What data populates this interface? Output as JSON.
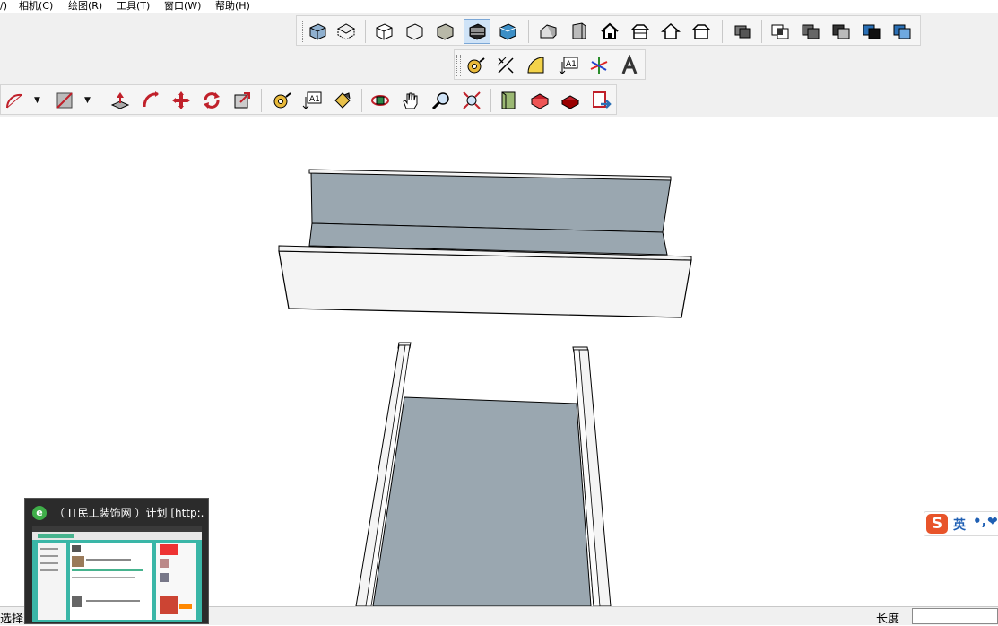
{
  "menu": [
    "/)",
    "相机(C)",
    "绘图(R)",
    "工具(T)",
    "窗口(W)",
    "帮助(H)"
  ],
  "toolbars": {
    "views": [
      "iso-view-icon",
      "top-view-icon",
      "front-view-icon",
      "right-view-icon",
      "back-view-icon",
      "left-view-icon"
    ],
    "styles": [
      "xray-style-icon",
      "wireframe-style-icon",
      "hidden-line-style-icon",
      "shaded-style-icon",
      "shaded-texture-style-icon",
      "monochrome-style-icon"
    ],
    "sections": [
      "outer-shell-icon",
      "intersect-icon",
      "union-icon",
      "subtract-icon",
      "trim-icon",
      "split-icon"
    ],
    "construction": [
      "tape-measure-icon",
      "dimension-icon",
      "protractor-icon",
      "text-label-icon",
      "axes-icon",
      "3d-text-icon"
    ],
    "main": [
      "arc-icon",
      "rectangle-icon",
      "push-pull-icon",
      "follow-me-icon",
      "move-icon",
      "rotate-icon",
      "scale-icon",
      "tape-measure-icon",
      "text-label-icon",
      "paint-bucket-icon",
      "orbit-icon",
      "pan-icon",
      "zoom-icon",
      "zoom-extents-icon",
      "3d-warehouse-icon",
      "extension-warehouse-icon",
      "share-model-icon",
      "layout-send-icon"
    ]
  },
  "status": {
    "text": "选择对",
    "vcb_label": "长度",
    "vcb_value": ""
  },
  "taskbar_preview": {
    "title": "（ IT民工装饰网 ）计划 [http:...",
    "icon_letter": "e"
  },
  "ime": {
    "logo": "S",
    "mode": "英",
    "punct": "•,",
    "extra": "❤"
  },
  "colors": {
    "face_gray": "#9aa7b0",
    "face_white": "#f4f4f4",
    "edge": "#000000",
    "toolbar_bg": "#f0f0f0"
  }
}
